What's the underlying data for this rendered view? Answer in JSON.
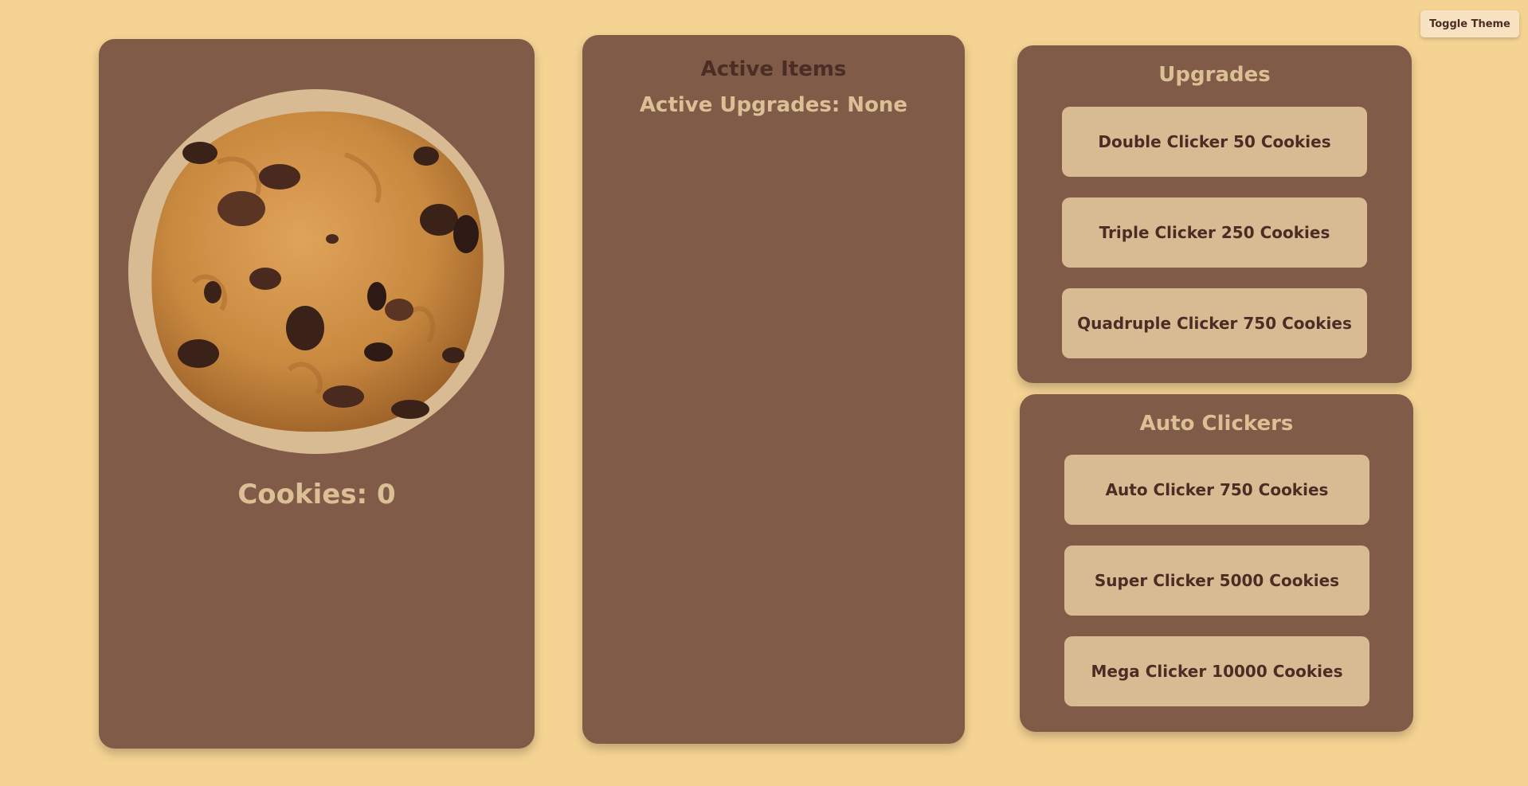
{
  "header": {
    "toggle_theme_label": "Toggle Theme"
  },
  "cookie_panel": {
    "cookie_count_text": "Cookies: 0"
  },
  "active_panel": {
    "title": "Active Items",
    "active_upgrades_text": "Active Upgrades: None"
  },
  "upgrades_panel": {
    "title": "Upgrades",
    "items": [
      {
        "label": "Double Clicker 50 Cookies"
      },
      {
        "label": "Triple Clicker 250 Cookies"
      },
      {
        "label": "Quadruple Clicker 750 Cookies"
      }
    ]
  },
  "auto_panel": {
    "title": "Auto Clickers",
    "items": [
      {
        "label": "Auto Clicker 750 Cookies"
      },
      {
        "label": "Super Clicker 5000 Cookies"
      },
      {
        "label": "Mega Clicker 10000 Cookies"
      }
    ]
  },
  "colors": {
    "background": "#f5d393",
    "panel": "#805b48",
    "button": "#d8bb93",
    "text_dark": "#4c2d25",
    "text_light": "#dcc095",
    "toggle_button": "#f7e2c1"
  },
  "icons": {
    "cookie": "chocolate-chip-cookie-icon"
  }
}
